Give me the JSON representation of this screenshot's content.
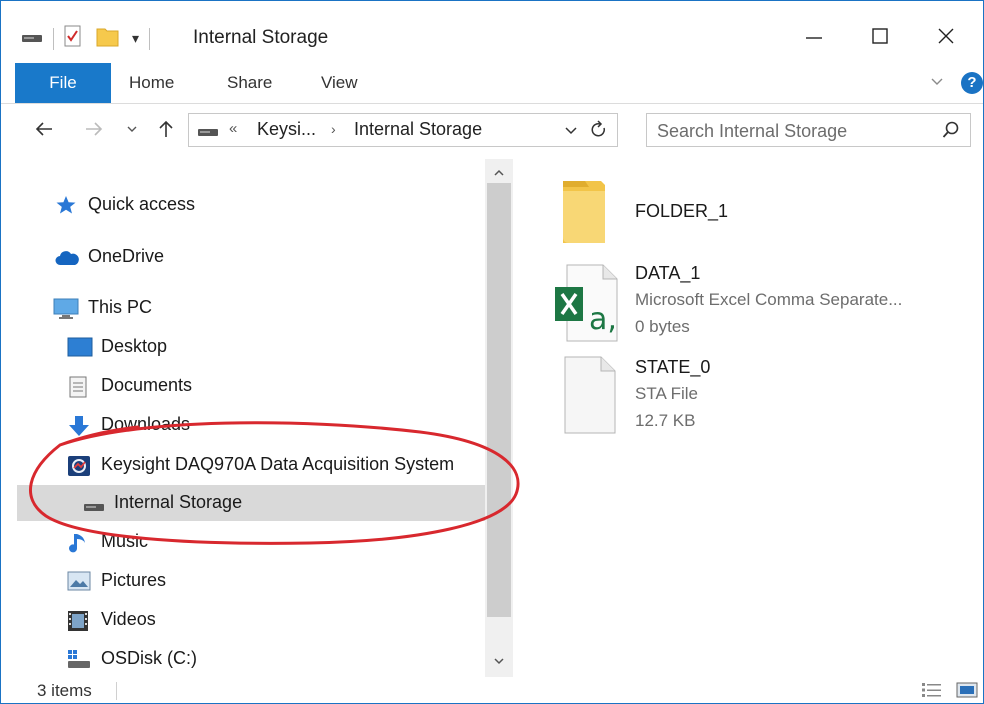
{
  "window": {
    "title": "Internal Storage",
    "qat_dropdown": "▾"
  },
  "ribbon": {
    "tabs": [
      {
        "label": "File"
      },
      {
        "label": "Home"
      },
      {
        "label": "Share"
      },
      {
        "label": "View"
      }
    ],
    "help": "?"
  },
  "address": {
    "overflow": "«",
    "crumbs": [
      "Keysi...",
      "Internal Storage"
    ],
    "crumb_sep": "›"
  },
  "search": {
    "placeholder": "Search Internal Storage"
  },
  "nav_pane": {
    "items": [
      {
        "label": "Quick access",
        "icon": "star-icon"
      },
      {
        "label": "OneDrive",
        "icon": "cloud-icon"
      },
      {
        "label": "This PC",
        "icon": "computer-icon"
      },
      {
        "label": "Desktop",
        "icon": "desktop-icon"
      },
      {
        "label": "Documents",
        "icon": "documents-icon"
      },
      {
        "label": "Downloads",
        "icon": "download-icon"
      },
      {
        "label": "Keysight DAQ970A Data Acquisition System",
        "icon": "device-icon"
      },
      {
        "label": "Internal Storage",
        "icon": "drive-icon",
        "selected": true
      },
      {
        "label": "Music",
        "icon": "music-icon"
      },
      {
        "label": "Pictures",
        "icon": "pictures-icon"
      },
      {
        "label": "Videos",
        "icon": "videos-icon"
      },
      {
        "label": "OSDisk (C:)",
        "icon": "disk-icon"
      }
    ]
  },
  "files": [
    {
      "name": "FOLDER_1",
      "icon": "folder-icon"
    },
    {
      "name": "DATA_1",
      "type": "Microsoft Excel Comma Separate...",
      "size": "0 bytes",
      "icon": "excel-csv-icon"
    },
    {
      "name": "STATE_0",
      "type": "STA File",
      "size": "12.7 KB",
      "icon": "blank-file-icon"
    }
  ],
  "status": {
    "item_count": "3 items"
  },
  "colors": {
    "accent": "#1979ca",
    "annotation": "#d8282e",
    "selection": "#d9d9d9"
  }
}
